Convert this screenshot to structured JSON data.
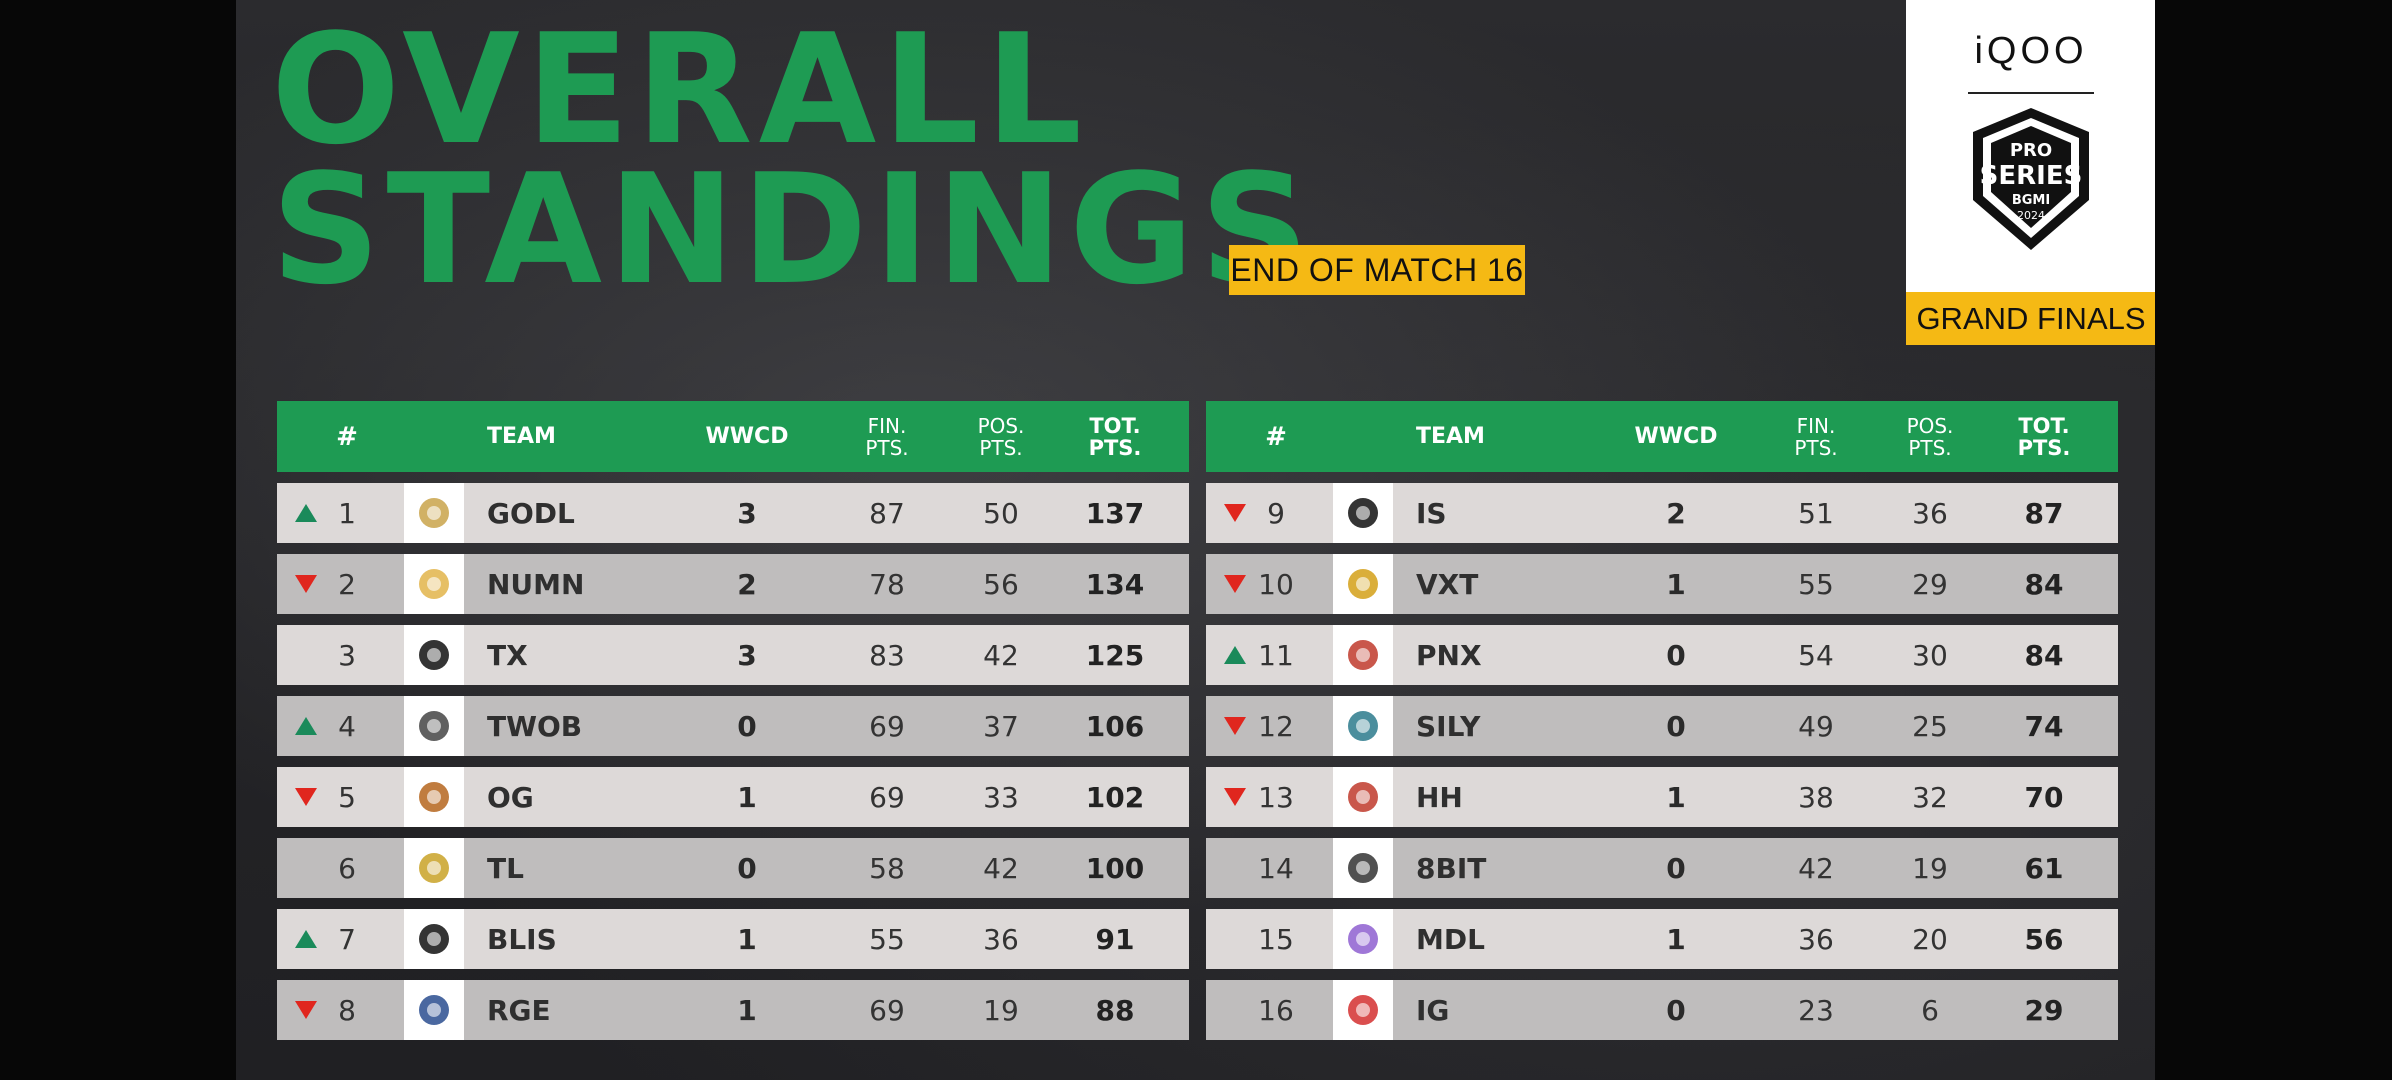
{
  "header": {
    "title_line1": "OVERALL",
    "title_line2": "STANDINGS",
    "match_label": "END OF MATCH 16"
  },
  "branding": {
    "sponsor": "iQOO",
    "stage_label": "GRAND FINALS",
    "crest_line1": "PRO",
    "crest_line2": "SERIES",
    "crest_line3": "BGMI",
    "crest_line4": "2024"
  },
  "columns": {
    "rank": "#",
    "team": "TEAM",
    "wwcd": "WWCD",
    "fin_1": "FIN.",
    "fin_2": "PTS.",
    "pos_1": "POS.",
    "pos_2": "PTS.",
    "tot_1": "TOT.",
    "tot_2": "PTS."
  },
  "colors": {
    "brand_green": "#1e9b53",
    "badge_yellow": "#f5b914",
    "trend_up": "#1a8a5a",
    "trend_down": "#e0261e"
  },
  "left_table": [
    {
      "trend": "up",
      "rank": "1",
      "team": "GODL",
      "logo_icon": "godl-logo-icon",
      "logo_color": "#c9a34a",
      "wwcd": "3",
      "fin": "87",
      "pos": "50",
      "tot": "137"
    },
    {
      "trend": "down",
      "rank": "2",
      "team": "NUMN",
      "logo_icon": "numn-logo-icon",
      "logo_color": "#e2b44a",
      "wwcd": "2",
      "fin": "78",
      "pos": "56",
      "tot": "134"
    },
    {
      "trend": "none",
      "rank": "3",
      "team": "TX",
      "logo_icon": "tx-logo-icon",
      "logo_color": "#111111",
      "wwcd": "3",
      "fin": "83",
      "pos": "42",
      "tot": "125"
    },
    {
      "trend": "up",
      "rank": "4",
      "team": "TWOB",
      "logo_icon": "twob-logo-icon",
      "logo_color": "#444444",
      "wwcd": "0",
      "fin": "69",
      "pos": "37",
      "tot": "106"
    },
    {
      "trend": "down",
      "rank": "5",
      "team": "OG",
      "logo_icon": "og-logo-icon",
      "logo_color": "#b5651d",
      "wwcd": "1",
      "fin": "69",
      "pos": "33",
      "tot": "102"
    },
    {
      "trend": "none",
      "rank": "6",
      "team": "TL",
      "logo_icon": "tl-logo-icon",
      "logo_color": "#c9a227",
      "wwcd": "0",
      "fin": "58",
      "pos": "42",
      "tot": "100"
    },
    {
      "trend": "up",
      "rank": "7",
      "team": "BLIS",
      "logo_icon": "blis-logo-icon",
      "logo_color": "#111111",
      "wwcd": "1",
      "fin": "55",
      "pos": "36",
      "tot": "91"
    },
    {
      "trend": "down",
      "rank": "8",
      "team": "RGE",
      "logo_icon": "rge-logo-icon",
      "logo_color": "#2a4d8f",
      "wwcd": "1",
      "fin": "69",
      "pos": "19",
      "tot": "88"
    }
  ],
  "right_table": [
    {
      "trend": "down",
      "rank": "9",
      "team": "IS",
      "logo_icon": "is-logo-icon",
      "logo_color": "#111111",
      "wwcd": "2",
      "fin": "51",
      "pos": "36",
      "tot": "87"
    },
    {
      "trend": "down",
      "rank": "10",
      "team": "VXT",
      "logo_icon": "vxt-logo-icon",
      "logo_color": "#d4a017",
      "wwcd": "1",
      "fin": "55",
      "pos": "29",
      "tot": "84"
    },
    {
      "trend": "up",
      "rank": "11",
      "team": "PNX",
      "logo_icon": "pnx-logo-icon",
      "logo_color": "#c0392b",
      "wwcd": "0",
      "fin": "54",
      "pos": "30",
      "tot": "84"
    },
    {
      "trend": "down",
      "rank": "12",
      "team": "SILY",
      "logo_icon": "sily-logo-icon",
      "logo_color": "#2b7a8c",
      "wwcd": "0",
      "fin": "49",
      "pos": "25",
      "tot": "74"
    },
    {
      "trend": "down",
      "rank": "13",
      "team": "HH",
      "logo_icon": "hh-logo-icon",
      "logo_color": "#c0392b",
      "wwcd": "1",
      "fin": "38",
      "pos": "32",
      "tot": "70"
    },
    {
      "trend": "none",
      "rank": "14",
      "team": "8BIT",
      "logo_icon": "8bit-logo-icon",
      "logo_color": "#333333",
      "wwcd": "0",
      "fin": "42",
      "pos": "19",
      "tot": "61"
    },
    {
      "trend": "none",
      "rank": "15",
      "team": "MDL",
      "logo_icon": "mdl-logo-icon",
      "logo_color": "#8e5fd0",
      "wwcd": "1",
      "fin": "36",
      "pos": "20",
      "tot": "56"
    },
    {
      "trend": "none",
      "rank": "16",
      "team": "IG",
      "logo_icon": "ig-logo-icon",
      "logo_color": "#d32f2f",
      "wwcd": "0",
      "fin": "23",
      "pos": "6",
      "tot": "29"
    }
  ]
}
